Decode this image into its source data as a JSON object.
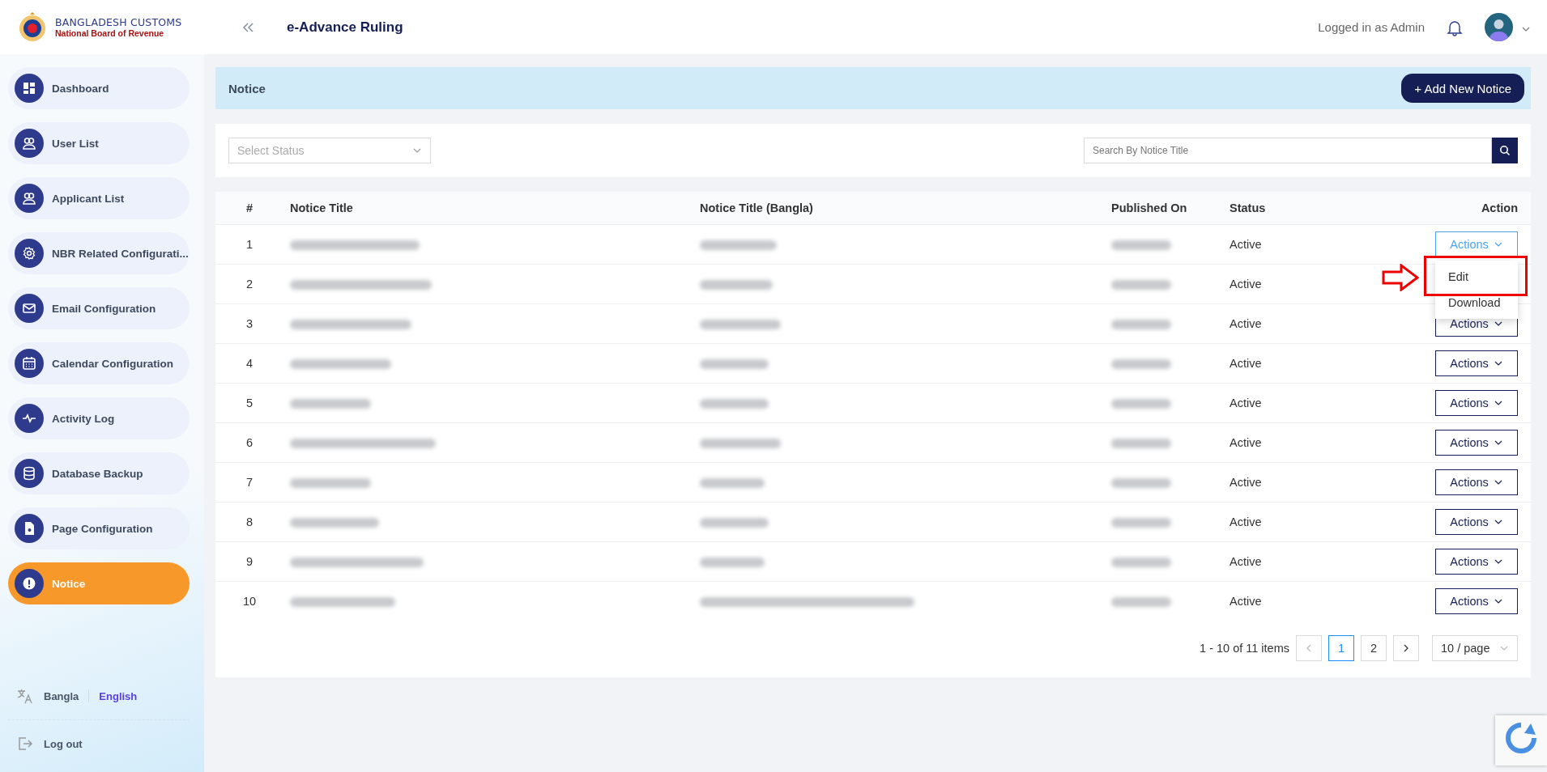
{
  "brand": {
    "title": "BANGLADESH CUSTOMS",
    "subtitle": "National Board of Revenue"
  },
  "header": {
    "app_title": "e-Advance Ruling",
    "user_label": "Logged in as Admin"
  },
  "sidebar": {
    "items": [
      {
        "label": "Dashboard",
        "selected": false
      },
      {
        "label": "User List",
        "selected": false
      },
      {
        "label": "Applicant List",
        "selected": false
      },
      {
        "label": "NBR Related Configurati...",
        "selected": false
      },
      {
        "label": "Email Configuration",
        "selected": false
      },
      {
        "label": "Calendar Configuration",
        "selected": false
      },
      {
        "label": "Activity Log",
        "selected": false
      },
      {
        "label": "Database Backup",
        "selected": false
      },
      {
        "label": "Page Configuration",
        "selected": false
      },
      {
        "label": "Notice",
        "selected": true
      }
    ]
  },
  "language": {
    "options": [
      {
        "label": "Bangla",
        "selected": false
      },
      {
        "label": "English",
        "selected": true
      }
    ]
  },
  "logout": "Log out",
  "page": {
    "title": "Notice",
    "add_button": "+ Add New Notice"
  },
  "filters": {
    "status_placeholder": "Select Status",
    "search_placeholder": "Search By Notice Title"
  },
  "table": {
    "columns": [
      "#",
      "Notice Title",
      "Notice Title (Bangla)",
      "Published On",
      "Status",
      "Action"
    ],
    "rows": [
      {
        "index": "1",
        "status": "Active",
        "action": "Actions",
        "open": true
      },
      {
        "index": "2",
        "status": "Active"
      },
      {
        "index": "3",
        "status": "Active",
        "action": "Actions",
        "open": false
      },
      {
        "index": "4",
        "status": "Active",
        "action": "Actions",
        "open": false
      },
      {
        "index": "5",
        "status": "Active",
        "action": "Actions",
        "open": false
      },
      {
        "index": "6",
        "status": "Active",
        "action": "Actions",
        "open": false
      },
      {
        "index": "7",
        "status": "Active",
        "action": "Actions",
        "open": false
      },
      {
        "index": "8",
        "status": "Active",
        "action": "Actions",
        "open": false
      },
      {
        "index": "9",
        "status": "Active",
        "action": "Actions",
        "open": false
      },
      {
        "index": "10",
        "status": "Active",
        "action": "Actions",
        "open": false
      }
    ]
  },
  "action_menu": {
    "items": [
      {
        "label": "Edit",
        "highlighted": true
      },
      {
        "label": "Download",
        "highlighted": false
      }
    ]
  },
  "pagination": {
    "summary": "1 - 10 of 11 items",
    "pages": [
      {
        "label": "1",
        "selected": true
      },
      {
        "label": "2",
        "selected": false
      }
    ],
    "page_size": "10 / page"
  }
}
